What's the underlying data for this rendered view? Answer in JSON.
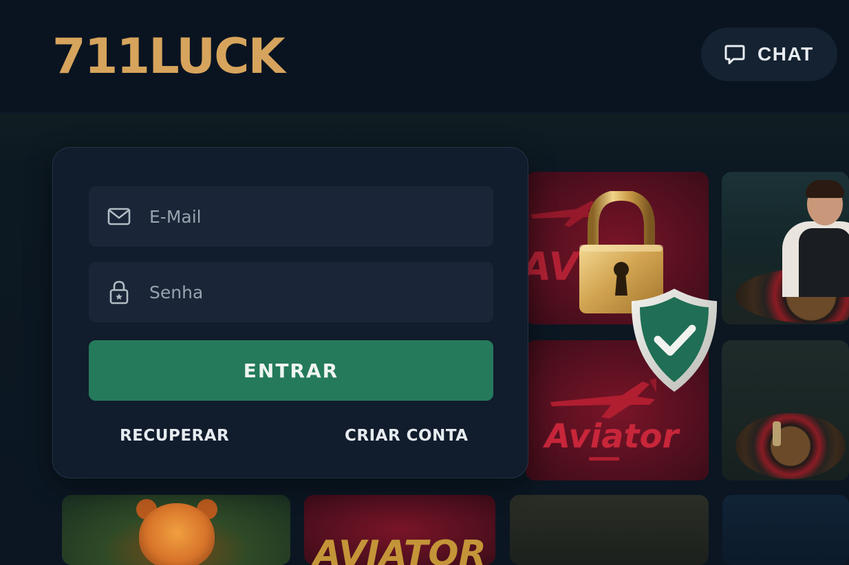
{
  "header": {
    "logo_text": "711LUCK",
    "chat_label": "CHAT",
    "chat_icon": "chat-bubble-icon"
  },
  "login": {
    "email_placeholder": "E-Mail",
    "email_value": "",
    "email_icon": "mail-icon",
    "password_placeholder": "Senha",
    "password_value": "",
    "password_icon": "lock-icon",
    "submit_label": "ENTRAR",
    "recover_label": "RECUPERAR",
    "create_account_label": "CRIAR CONTA"
  },
  "games": {
    "tile_aviator_top_text": "AVI",
    "tile_aviator_mid_text": "Aviator",
    "tile_aviator_bottom_text": "AVIATOR"
  },
  "security_overlay": {
    "lock_icon": "padlock-icon",
    "shield_icon": "shield-check-icon"
  },
  "colors": {
    "background": "#0b1522",
    "logo": "#d6a45c",
    "primary_button": "#257a5c",
    "card": "#121d2c",
    "field": "#1a2637",
    "game_red": "#5a1020",
    "shield": "#1f6e55"
  }
}
